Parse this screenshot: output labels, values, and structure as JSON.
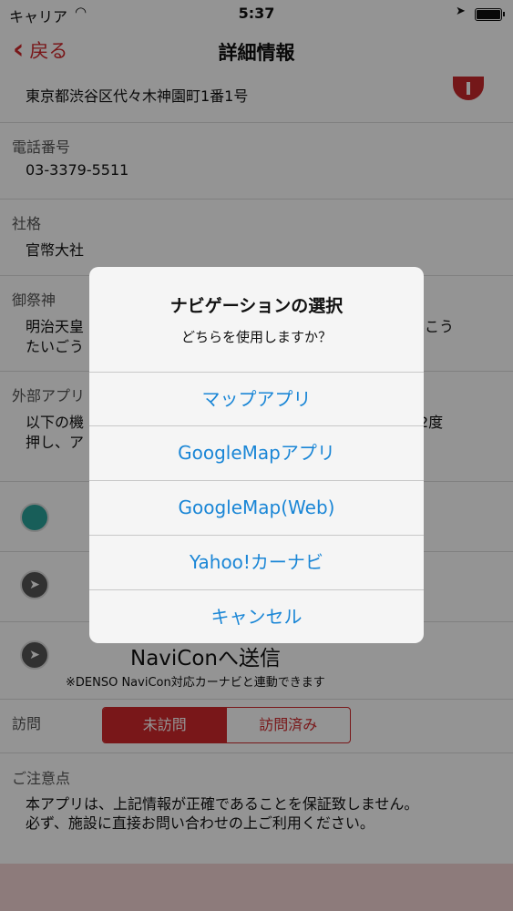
{
  "status_bar": {
    "carrier": "キャリア",
    "time": "5:37"
  },
  "nav": {
    "back_label": "戻る",
    "title": "詳細情報"
  },
  "address": {
    "value": "東京都渋谷区代々木神園町1番1号"
  },
  "phone": {
    "label": "電話番号",
    "value": "03-3379-5511"
  },
  "rank": {
    "label": "社格",
    "value": "官幣大社"
  },
  "deity": {
    "label": "御祭神",
    "value_left_1": "明治天皇",
    "value_right_1": "んこう",
    "value_left_2": "たいごう"
  },
  "external": {
    "label": "外部アプリ",
    "value_left_1": "以下の機",
    "value_right_1": "2度",
    "value_left_2": "押し、ア"
  },
  "navicon": {
    "label": "NaviConへ送信",
    "note": "※DENSO NaviCon対応カーナビと連動できます"
  },
  "visit": {
    "label": "訪問",
    "options": [
      "未訪問",
      "訪問済み"
    ],
    "selected": "未訪問"
  },
  "notice": {
    "label": "ご注意点",
    "line1": "本アプリは、上記情報が正確であることを保証致しません。",
    "line2": "必ず、施設に直接お問い合わせの上ご利用ください。"
  },
  "alert": {
    "title": "ナビゲーションの選択",
    "message": "どちらを使用しますか？",
    "buttons": [
      "マップアプリ",
      "GoogleMapアプリ",
      "GoogleMap(Web)",
      "Yahoo!カーナビ",
      "キャンセル"
    ]
  },
  "colors": {
    "accent": "#d0282c",
    "link_blue": "#1a86d6",
    "bottom_bar": "#f3d4d4"
  }
}
